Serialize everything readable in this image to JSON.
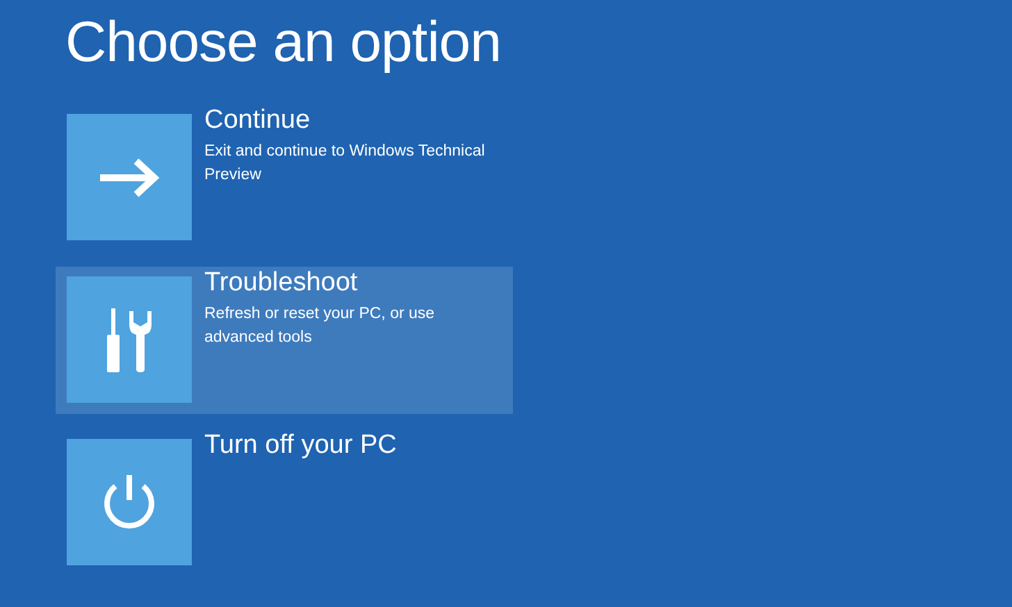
{
  "title": "Choose an option",
  "options": [
    {
      "kind": "arrow",
      "label": "Continue",
      "description": "Exit and continue to Windows Technical Preview",
      "selected": false
    },
    {
      "kind": "tools",
      "label": "Troubleshoot",
      "description": "Refresh or reset your PC, or use advanced tools",
      "selected": true
    },
    {
      "kind": "power",
      "label": "Turn off your PC",
      "selected": false
    }
  ]
}
